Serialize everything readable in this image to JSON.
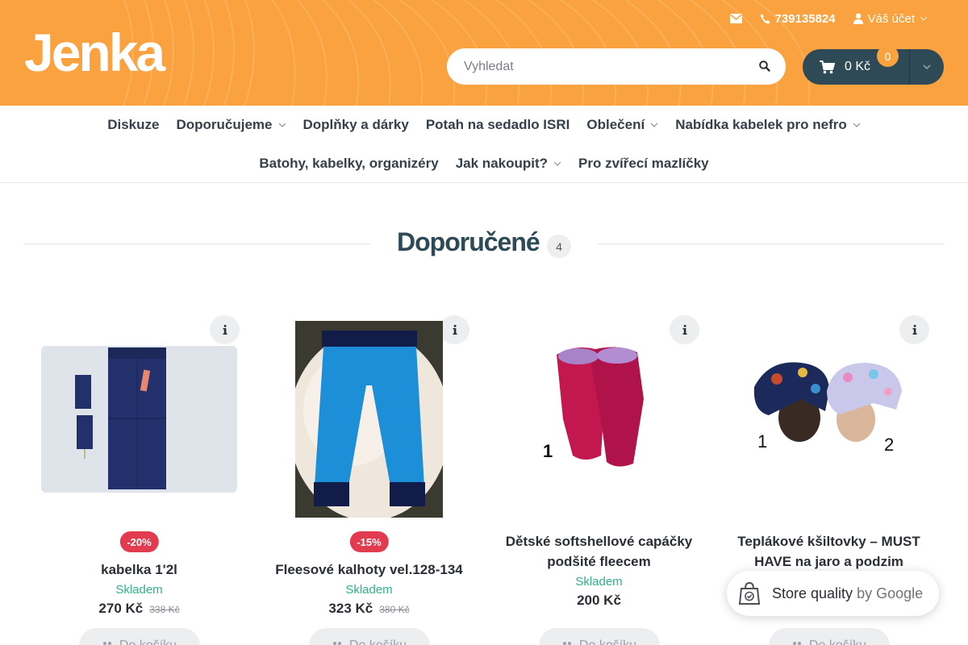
{
  "header": {
    "logo": "Jenka",
    "email_icon": "envelope-icon",
    "phone": "739135824",
    "account_label": "Váš účet",
    "search_placeholder": "Vyhledat",
    "cart_total": "0 Kč",
    "cart_count": "0",
    "colors": {
      "header_bg": "#f9a23f",
      "cart_bg": "#2d4a56"
    }
  },
  "nav": {
    "row1": [
      {
        "label": "Diskuze",
        "dropdown": false
      },
      {
        "label": "Doporučujeme",
        "dropdown": true
      },
      {
        "label": "Doplňky a dárky",
        "dropdown": false
      },
      {
        "label": "Potah na sedadlo ISRI",
        "dropdown": false
      },
      {
        "label": "Oblečení",
        "dropdown": true
      },
      {
        "label": "Nabídka kabelek pro nefro",
        "dropdown": true
      }
    ],
    "row2": [
      {
        "label": "Batohy, kabelky, organizéry",
        "dropdown": false
      },
      {
        "label": "Jak nakoupit?",
        "dropdown": true
      },
      {
        "label": "Pro zvířecí mazlíčky",
        "dropdown": false
      }
    ]
  },
  "section": {
    "title": "Doporučené",
    "count": "4"
  },
  "products": [
    {
      "discount": "-20%",
      "name": "kabelka 1'2l",
      "stock": "Skladem",
      "price": "270 Kč",
      "old_price": "338 Kč",
      "buy_label": "Do košíku"
    },
    {
      "discount": "-15%",
      "name": "Fleesové kalhoty vel.128-134",
      "stock": "Skladem",
      "price": "323 Kč",
      "old_price": "380 Kč",
      "buy_label": "Do košíku"
    },
    {
      "discount": "",
      "name_line1": "Dětské softshellové capáčky",
      "name_line2": "podšité fleecem",
      "stock": "Skladem",
      "price": "200 Kč",
      "old_price": "",
      "buy_label": "Do košíku",
      "image_number": "1"
    },
    {
      "discount": "",
      "name_line1": "Teplákové kšiltovky – MUST",
      "name_line2": "HAVE na jaro a podzim",
      "stock": "",
      "price": "",
      "old_price": "",
      "buy_label": "Do košíku",
      "image_numbers": [
        "1",
        "2"
      ]
    }
  ],
  "google_badge": {
    "text": "Store quality",
    "by": "by Google"
  }
}
